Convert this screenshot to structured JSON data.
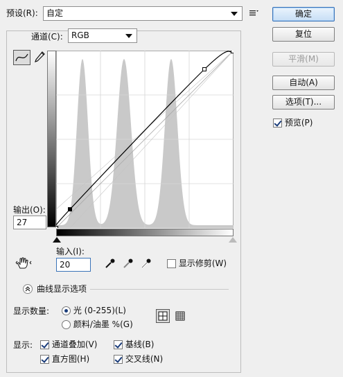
{
  "preset": {
    "label": "预设(R):",
    "value": "自定"
  },
  "channel": {
    "label": "通道(C):",
    "value": "RGB"
  },
  "buttons": {
    "ok": "确定",
    "reset": "复位",
    "smooth": "平滑(M)",
    "auto": "自动(A)",
    "options": "选项(T)..."
  },
  "preview": {
    "label": "预览(P)",
    "checked": true
  },
  "output": {
    "label": "输出(O):",
    "value": "27"
  },
  "input": {
    "label": "输入(I):",
    "value": "20"
  },
  "show_clipping": {
    "label": "显示修剪(W)",
    "checked": false
  },
  "curve_options_label": "曲线显示选项",
  "show_amount": {
    "label": "显示数量:",
    "light": "光 (0-255)(L)",
    "pigment": "颜料/油墨 %(G)",
    "selected": "light"
  },
  "show": {
    "label": "显示:",
    "channel_overlays": "通道叠加(V)",
    "baseline": "基线(B)",
    "histogram": "直方图(H)",
    "intersection": "交叉线(N)"
  },
  "curve_points": [
    [
      0,
      0
    ],
    [
      20,
      27
    ],
    [
      214,
      229
    ],
    [
      255,
      255
    ]
  ],
  "histogram_peaks_input": [
    38,
    98,
    166
  ],
  "colors": {
    "histogram": "#c9c9c9",
    "grid": "#d6d6d6",
    "curve": "#000000",
    "accent": "#3a73b8"
  }
}
